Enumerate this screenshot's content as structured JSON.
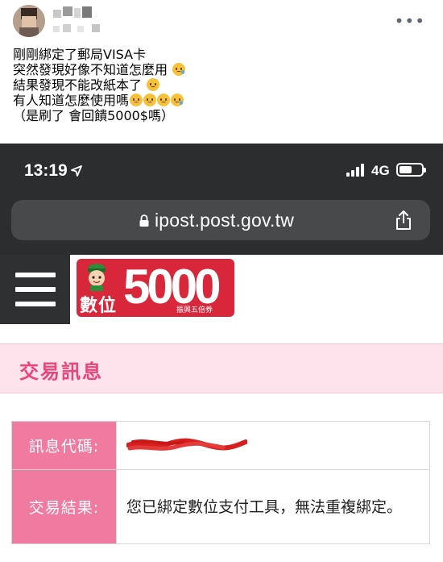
{
  "post": {
    "lines": [
      "剛剛綁定了郵局VISA卡",
      "突然發現好像不知道怎麼用",
      "結果發現不能改紙本了",
      "有人知道怎麼使用嗎",
      "（是刷了 會回饋5000$嗎）"
    ],
    "more_icon": "more-horizontal-icon"
  },
  "phone": {
    "time": "13:19",
    "network": "4G",
    "url": "ipost.post.gov.tw",
    "icons": [
      "location-arrow-icon",
      "signal-bars-icon",
      "battery-icon",
      "lock-icon",
      "share-icon"
    ]
  },
  "site": {
    "logo": {
      "word": "數位",
      "number": "5000",
      "sub": "振興五倍券"
    },
    "title": "交易訊息",
    "table": {
      "code_label": "訊息代碼:",
      "result_label": "交易結果:",
      "result_value": "您已綁定數位支付工具，無法重複綁定。"
    },
    "colors": {
      "brand_red": "#d8273a",
      "label_pink": "#f07aa0",
      "title_pink": "#e8457b",
      "band_pink": "#fde4ec"
    }
  }
}
